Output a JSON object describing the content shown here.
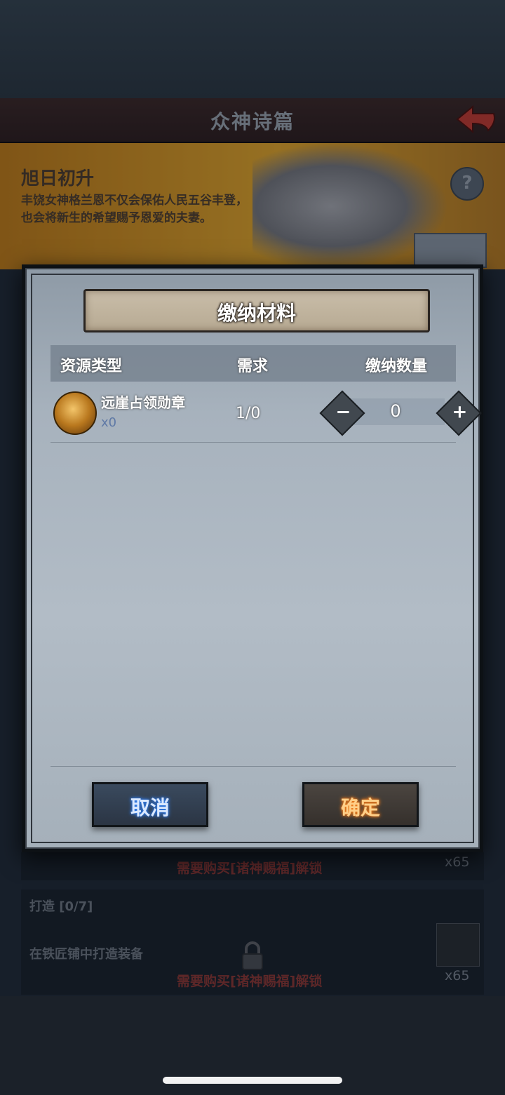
{
  "header": {
    "title": "众神诗篇"
  },
  "banner": {
    "title": "旭日初升",
    "desc_line1": "丰饶女神格兰恩不仅会保佑人民五谷丰登，",
    "desc_line2": "也会将新生的希望赐予恩爱的夫妻。"
  },
  "modal": {
    "title": "缴纳材料",
    "columns": [
      "资源类型",
      "需求",
      "缴纳数量"
    ],
    "item": {
      "name": "远崖占领勋章",
      "owned": "x0",
      "requirement": "1/0",
      "quantity": "0"
    },
    "cancel_label": "取消",
    "confirm_label": "确定"
  },
  "background_tasks": {
    "locked_notice_1": "需要购买[诸神赐福]解锁",
    "reward_count_1": "x65",
    "forge_title": "打造 [0/7]",
    "forge_desc": "在铁匠铺中打造装备",
    "locked_notice_2": "需要购买[诸神赐福]解锁",
    "reward_count_2": "x65"
  },
  "colors": {
    "cancel_glow": "#3b8cff",
    "confirm_glow": "#ff8a20",
    "locked_text": "#8a3531"
  }
}
